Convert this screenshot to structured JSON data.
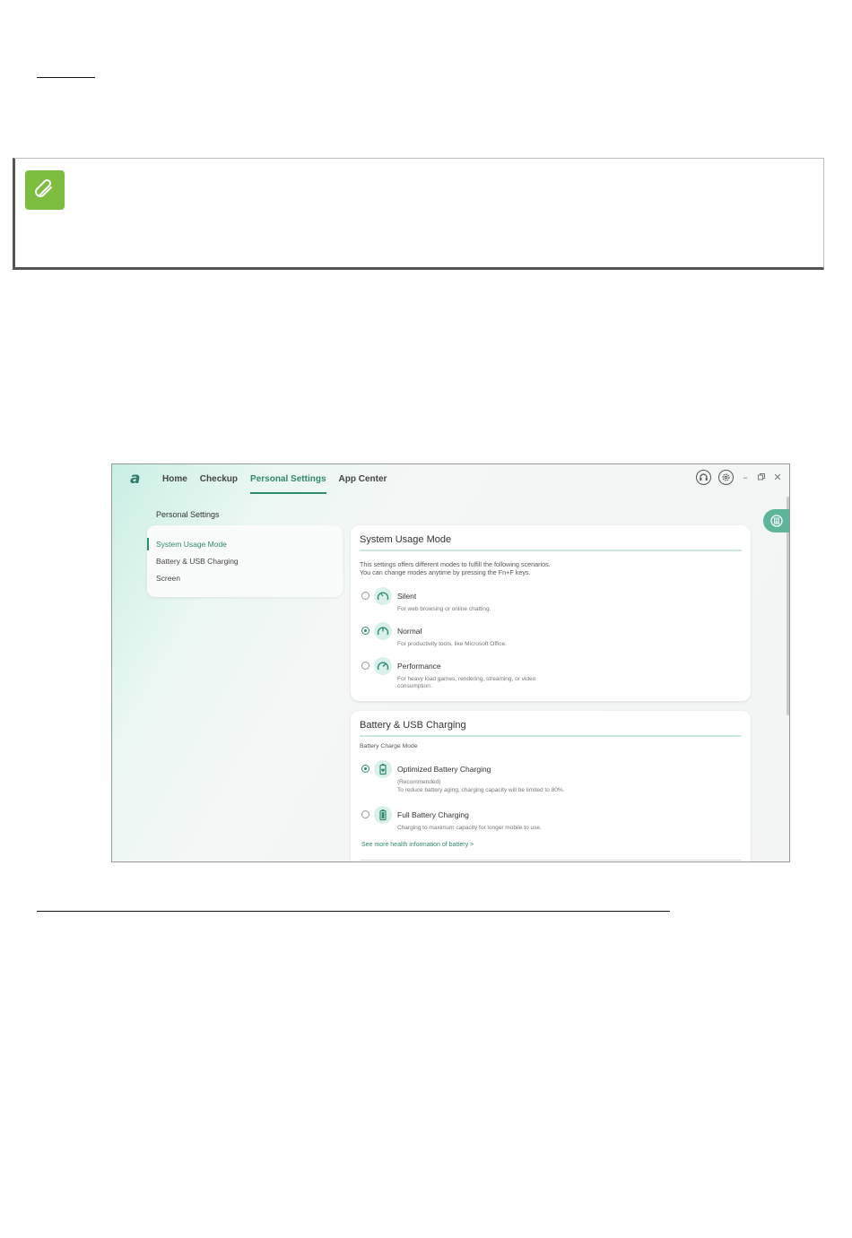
{
  "app": {
    "logo": "a",
    "nav": [
      "Home",
      "Checkup",
      "Personal Settings",
      "App Center"
    ],
    "active_nav": "Personal Settings",
    "page_heading": "Personal Settings",
    "sidebar": {
      "items": [
        {
          "label": "System Usage Mode",
          "active": true
        },
        {
          "label": "Battery & USB Charging",
          "active": false
        },
        {
          "label": "Screen",
          "active": false
        }
      ]
    },
    "usage_card": {
      "title": "System Usage Mode",
      "description_1": "This settings offers different modes to fulfill the following scenarios.",
      "description_2": "You can change modes anytime by pressing the Fn+F keys.",
      "options": [
        {
          "label": "Silent",
          "sub": "For web browsing or online chatting.",
          "checked": false,
          "icon": "silent-mode-icon"
        },
        {
          "label": "Normal",
          "sub": "For productivity tools, like Microsoft Office.",
          "checked": true,
          "icon": "normal-mode-icon"
        },
        {
          "label": "Performance",
          "sub": "For heavy load games, rendering, streaming, or video consumption.",
          "checked": false,
          "icon": "performance-mode-icon"
        }
      ]
    },
    "battery_card": {
      "title": "Battery & USB Charging",
      "section_label": "Battery Charge Mode",
      "options": [
        {
          "label": "Optimized Battery Charging",
          "sub_1": "(Recommended)",
          "sub_2": "To reduce battery aging, charging capacity will be limited to 80%.",
          "checked": true,
          "icon": "battery-optimized-icon"
        },
        {
          "label": "Full Battery Charging",
          "sub_1": "Charging to maximum capacity for longer mobile to use.",
          "checked": false,
          "icon": "battery-full-icon"
        }
      ],
      "link": "See more health information of battery >"
    },
    "colors": {
      "accent": "#2f8a6f",
      "note_icon": "#7cbc3f"
    }
  }
}
